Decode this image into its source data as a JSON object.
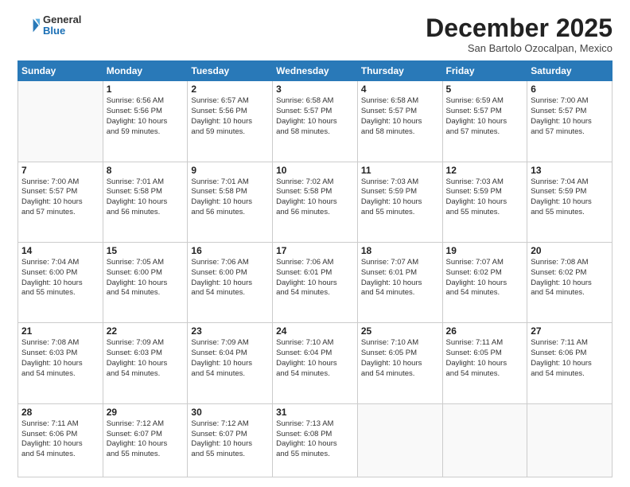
{
  "logo": {
    "general": "General",
    "blue": "Blue"
  },
  "header": {
    "month": "December 2025",
    "location": "San Bartolo Ozocalpan, Mexico"
  },
  "days_of_week": [
    "Sunday",
    "Monday",
    "Tuesday",
    "Wednesday",
    "Thursday",
    "Friday",
    "Saturday"
  ],
  "weeks": [
    [
      {
        "day": "",
        "info": ""
      },
      {
        "day": "1",
        "info": "Sunrise: 6:56 AM\nSunset: 5:56 PM\nDaylight: 10 hours\nand 59 minutes."
      },
      {
        "day": "2",
        "info": "Sunrise: 6:57 AM\nSunset: 5:56 PM\nDaylight: 10 hours\nand 59 minutes."
      },
      {
        "day": "3",
        "info": "Sunrise: 6:58 AM\nSunset: 5:57 PM\nDaylight: 10 hours\nand 58 minutes."
      },
      {
        "day": "4",
        "info": "Sunrise: 6:58 AM\nSunset: 5:57 PM\nDaylight: 10 hours\nand 58 minutes."
      },
      {
        "day": "5",
        "info": "Sunrise: 6:59 AM\nSunset: 5:57 PM\nDaylight: 10 hours\nand 57 minutes."
      },
      {
        "day": "6",
        "info": "Sunrise: 7:00 AM\nSunset: 5:57 PM\nDaylight: 10 hours\nand 57 minutes."
      }
    ],
    [
      {
        "day": "7",
        "info": "Sunrise: 7:00 AM\nSunset: 5:57 PM\nDaylight: 10 hours\nand 57 minutes."
      },
      {
        "day": "8",
        "info": "Sunrise: 7:01 AM\nSunset: 5:58 PM\nDaylight: 10 hours\nand 56 minutes."
      },
      {
        "day": "9",
        "info": "Sunrise: 7:01 AM\nSunset: 5:58 PM\nDaylight: 10 hours\nand 56 minutes."
      },
      {
        "day": "10",
        "info": "Sunrise: 7:02 AM\nSunset: 5:58 PM\nDaylight: 10 hours\nand 56 minutes."
      },
      {
        "day": "11",
        "info": "Sunrise: 7:03 AM\nSunset: 5:59 PM\nDaylight: 10 hours\nand 55 minutes."
      },
      {
        "day": "12",
        "info": "Sunrise: 7:03 AM\nSunset: 5:59 PM\nDaylight: 10 hours\nand 55 minutes."
      },
      {
        "day": "13",
        "info": "Sunrise: 7:04 AM\nSunset: 5:59 PM\nDaylight: 10 hours\nand 55 minutes."
      }
    ],
    [
      {
        "day": "14",
        "info": "Sunrise: 7:04 AM\nSunset: 6:00 PM\nDaylight: 10 hours\nand 55 minutes."
      },
      {
        "day": "15",
        "info": "Sunrise: 7:05 AM\nSunset: 6:00 PM\nDaylight: 10 hours\nand 54 minutes."
      },
      {
        "day": "16",
        "info": "Sunrise: 7:06 AM\nSunset: 6:00 PM\nDaylight: 10 hours\nand 54 minutes."
      },
      {
        "day": "17",
        "info": "Sunrise: 7:06 AM\nSunset: 6:01 PM\nDaylight: 10 hours\nand 54 minutes."
      },
      {
        "day": "18",
        "info": "Sunrise: 7:07 AM\nSunset: 6:01 PM\nDaylight: 10 hours\nand 54 minutes."
      },
      {
        "day": "19",
        "info": "Sunrise: 7:07 AM\nSunset: 6:02 PM\nDaylight: 10 hours\nand 54 minutes."
      },
      {
        "day": "20",
        "info": "Sunrise: 7:08 AM\nSunset: 6:02 PM\nDaylight: 10 hours\nand 54 minutes."
      }
    ],
    [
      {
        "day": "21",
        "info": "Sunrise: 7:08 AM\nSunset: 6:03 PM\nDaylight: 10 hours\nand 54 minutes."
      },
      {
        "day": "22",
        "info": "Sunrise: 7:09 AM\nSunset: 6:03 PM\nDaylight: 10 hours\nand 54 minutes."
      },
      {
        "day": "23",
        "info": "Sunrise: 7:09 AM\nSunset: 6:04 PM\nDaylight: 10 hours\nand 54 minutes."
      },
      {
        "day": "24",
        "info": "Sunrise: 7:10 AM\nSunset: 6:04 PM\nDaylight: 10 hours\nand 54 minutes."
      },
      {
        "day": "25",
        "info": "Sunrise: 7:10 AM\nSunset: 6:05 PM\nDaylight: 10 hours\nand 54 minutes."
      },
      {
        "day": "26",
        "info": "Sunrise: 7:11 AM\nSunset: 6:05 PM\nDaylight: 10 hours\nand 54 minutes."
      },
      {
        "day": "27",
        "info": "Sunrise: 7:11 AM\nSunset: 6:06 PM\nDaylight: 10 hours\nand 54 minutes."
      }
    ],
    [
      {
        "day": "28",
        "info": "Sunrise: 7:11 AM\nSunset: 6:06 PM\nDaylight: 10 hours\nand 54 minutes."
      },
      {
        "day": "29",
        "info": "Sunrise: 7:12 AM\nSunset: 6:07 PM\nDaylight: 10 hours\nand 55 minutes."
      },
      {
        "day": "30",
        "info": "Sunrise: 7:12 AM\nSunset: 6:07 PM\nDaylight: 10 hours\nand 55 minutes."
      },
      {
        "day": "31",
        "info": "Sunrise: 7:13 AM\nSunset: 6:08 PM\nDaylight: 10 hours\nand 55 minutes."
      },
      {
        "day": "",
        "info": ""
      },
      {
        "day": "",
        "info": ""
      },
      {
        "day": "",
        "info": ""
      }
    ]
  ]
}
